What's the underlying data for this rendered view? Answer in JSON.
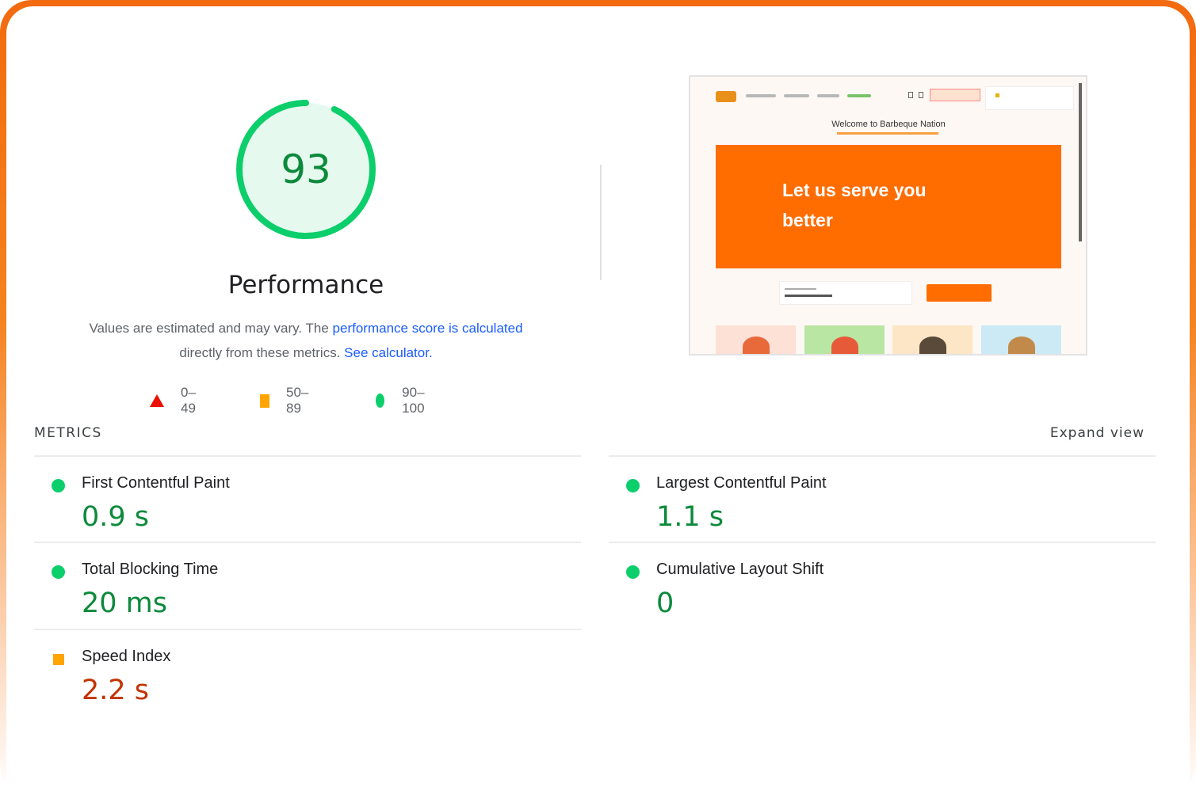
{
  "score": {
    "value": "93",
    "fraction": 0.93,
    "title": "Performance",
    "color": "#0cce6b"
  },
  "description": {
    "text1": "Values are estimated and may vary. The ",
    "link1": "performance score is calculated",
    "text2": "directly from these metrics. ",
    "link2": "See calculator."
  },
  "legend": [
    {
      "icon": "triangle-red",
      "label": "0–49"
    },
    {
      "icon": "square-orange",
      "label": "50–89"
    },
    {
      "icon": "circle-green",
      "label": "90–100"
    }
  ],
  "screenshot": {
    "welcome": "Welcome to Barbeque Nation",
    "banner_line1": "Let us serve you",
    "banner_line2": "better"
  },
  "metrics_header": "METRICS",
  "expand_view": "Expand view",
  "metrics": {
    "fcp": {
      "name": "First Contentful Paint",
      "value": "0.9 s",
      "status": "good",
      "color": "#0c8a3b"
    },
    "lcp": {
      "name": "Largest Contentful Paint",
      "value": "1.1 s",
      "status": "good",
      "color": "#0c8a3b"
    },
    "tbt": {
      "name": "Total Blocking Time",
      "value": "20 ms",
      "status": "good",
      "color": "#0c8a3b"
    },
    "cls": {
      "name": "Cumulative Layout Shift",
      "value": "0",
      "status": "good",
      "color": "#0c8a3b"
    },
    "si": {
      "name": "Speed Index",
      "value": "2.2 s",
      "status": "average",
      "color": "#c33300"
    }
  }
}
